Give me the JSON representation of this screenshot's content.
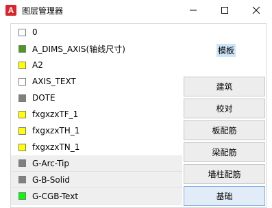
{
  "window": {
    "title": "图层管理器",
    "app_icon_text": "A",
    "controls": {
      "minimize": "—",
      "maximize": "☐",
      "close": "✕"
    }
  },
  "layers": [
    {
      "name": "0",
      "color": "#ffffff"
    },
    {
      "name": "A_DIMS_AXIS(轴线尺寸)",
      "color": "#4c9a1c"
    },
    {
      "name": "A2",
      "color": "#ffff00"
    },
    {
      "name": "AXIS_TEXT",
      "color": "#ffffff"
    },
    {
      "name": "DOTE",
      "color": "#808080"
    },
    {
      "name": "fxgxzxTF_1",
      "color": "#ffff00"
    },
    {
      "name": "fxgxzxTH_1",
      "color": "#ffff00"
    },
    {
      "name": "fxgxzxTN_1",
      "color": "#ffff00"
    },
    {
      "name": "G-Arc-Tip",
      "color": "#808080"
    },
    {
      "name": "G-B-Solid",
      "color": "#808080"
    },
    {
      "name": "G-CGB-Text",
      "color": "#00ff00"
    }
  ],
  "template_label": "模板",
  "buttons": [
    "建筑",
    "校对",
    "板配筋",
    "梁配筋",
    "墙柱配筋",
    "基础"
  ],
  "active_button": "基础"
}
